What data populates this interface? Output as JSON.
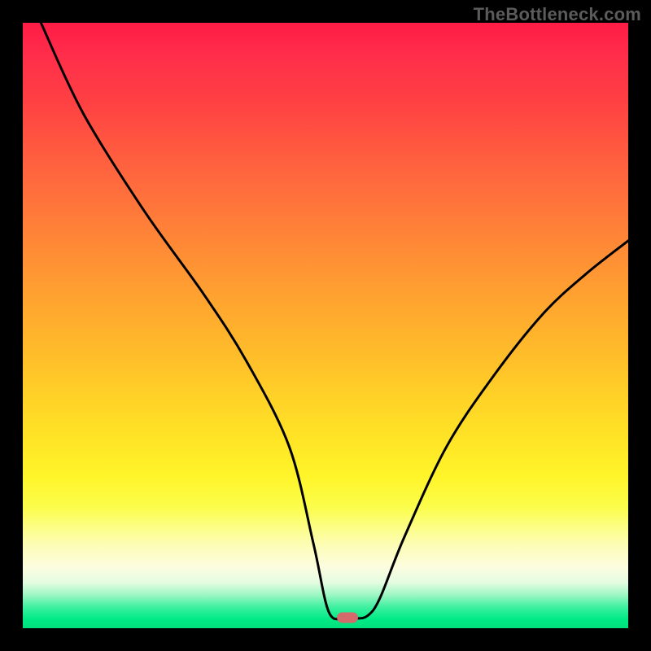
{
  "watermark": "TheBottleneck.com",
  "chart_data": {
    "type": "line",
    "title": "",
    "xlabel": "",
    "ylabel": "",
    "xlim": [
      0,
      100
    ],
    "ylim": [
      0,
      100
    ],
    "grid": false,
    "legend": false,
    "series": [
      {
        "name": "curve",
        "x": [
          3,
          10,
          20,
          30,
          37,
          44,
          48,
          50.5,
          53,
          55,
          57,
          59,
          63,
          70,
          78,
          86,
          93,
          100
        ],
        "y": [
          100,
          85,
          69,
          55,
          44,
          30,
          14,
          2.8,
          1.6,
          1.6,
          2.1,
          5,
          15,
          30,
          42,
          52,
          58.5,
          64
        ]
      }
    ],
    "background_gradient": {
      "top": "#ff1c46",
      "mid": "#ffd227",
      "bottom": "#00e07b"
    },
    "marker": {
      "x_pct": 53.6,
      "y_pct_from_top": 98.3,
      "color": "#d46a6c"
    },
    "curve_color": "#000000",
    "curve_stroke_width": 3
  }
}
